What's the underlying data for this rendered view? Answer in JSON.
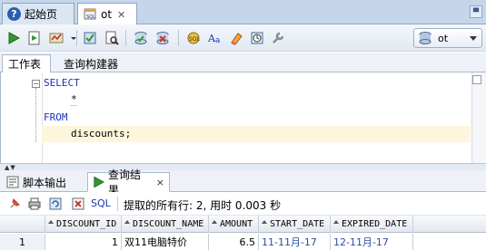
{
  "doc_tabs": [
    {
      "label": "起始页",
      "icon": "help-icon"
    },
    {
      "label": "ot",
      "icon": "sql-worksheet-icon",
      "close": "✕"
    }
  ],
  "toolbar": {
    "connection": "ot"
  },
  "editor_tabs": [
    "工作表",
    "查询构建器"
  ],
  "editor": {
    "lines": [
      "SELECT",
      "*",
      "FROM",
      "discounts;"
    ]
  },
  "output_tabs": [
    {
      "label": "脚本输出",
      "icon": "script-output-icon"
    },
    {
      "label": "查询结果",
      "icon": "query-result-icon",
      "close": "×"
    }
  ],
  "results_toolbar": {
    "sql_label": "SQL",
    "status": "提取的所有行: 2, 用时 0.003 秒"
  },
  "grid": {
    "columns": [
      "DISCOUNT_ID",
      "DISCOUNT_NAME",
      "AMOUNT",
      "START_DATE",
      "EXPIRED_DATE"
    ],
    "rows": [
      {
        "rownum": "1",
        "cells": [
          "1",
          "双11电脑特价",
          "6.5",
          "11-11月-17",
          "12-11月-17"
        ]
      }
    ]
  },
  "colors": {
    "keyword": "#1a33b8",
    "tab_strip": "#c6d6ea",
    "current_line": "#fdf6dc",
    "date_value": "#2a4fa8"
  }
}
